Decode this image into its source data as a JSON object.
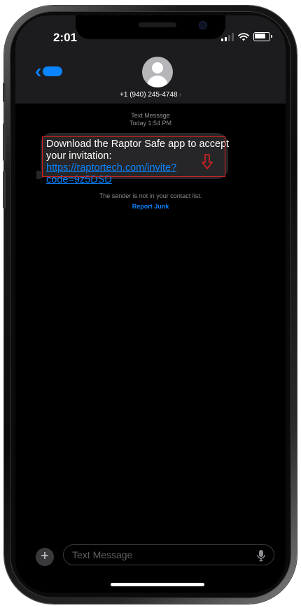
{
  "status": {
    "time": "2:01"
  },
  "header": {
    "contact": "+1 (940) 245-4748",
    "contact_chevron": "›"
  },
  "thread": {
    "type": "Text Message",
    "timestamp": "Today 1:54 PM",
    "message_prefix": "Download the Raptor Safe app to accept your invitation: ",
    "message_link": "https://raptortech.com/invite?code=9z5DSD",
    "sender_note": "The sender is not in your contact list.",
    "report_junk": "Report Junk"
  },
  "composer": {
    "placeholder": "Text Message",
    "plus": "+"
  },
  "icons": {
    "back": "chevron-left-icon",
    "avatar": "person-icon",
    "mic": "microphone-icon",
    "signal": "signal-icon",
    "wifi": "wifi-icon",
    "battery": "battery-icon",
    "annotation_arrow": "arrow-down-icon"
  },
  "colors": {
    "accent": "#0a84ff",
    "bubble": "#262628",
    "highlight": "#e02020",
    "header": "#1c1c1e",
    "background": "#000000"
  }
}
